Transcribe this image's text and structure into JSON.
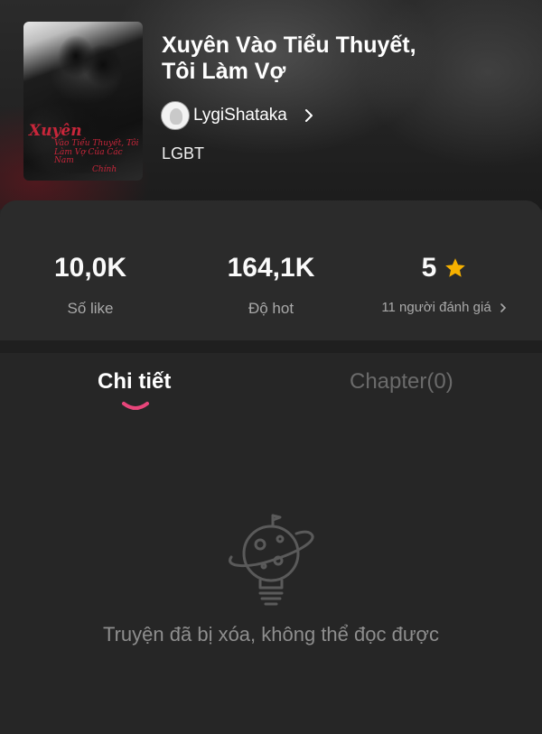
{
  "book": {
    "title": "Xuyên Vào Tiểu Thuyết, Tôi Làm Vợ",
    "cover_title_big": "Xuyên",
    "cover_title_small_1": "Vào Tiểu Thuyết, Tôi",
    "cover_title_small_2": "Làm Vợ Của Các Nam",
    "cover_title_small_3": "Chính",
    "author": "LygiShataka",
    "genre": "LGBT"
  },
  "stats": {
    "likes_value": "10,0K",
    "likes_label": "Số like",
    "hot_value": "164,1K",
    "hot_label": "Độ hot",
    "rating_value": "5",
    "rating_label": "11 người đánh giá"
  },
  "tabs": [
    {
      "label": "Chi tiết"
    },
    {
      "label": "Chapter(0)"
    }
  ],
  "empty_state": {
    "message": "Truyện đã bị xóa, không thể đọc được"
  },
  "colors": {
    "accent_pink": "#e8457a",
    "star": "#f6b100",
    "background": "#262626"
  },
  "icons": {
    "chevron": "chevron-right-icon",
    "star": "star-icon",
    "empty": "planet-bulb-icon"
  }
}
